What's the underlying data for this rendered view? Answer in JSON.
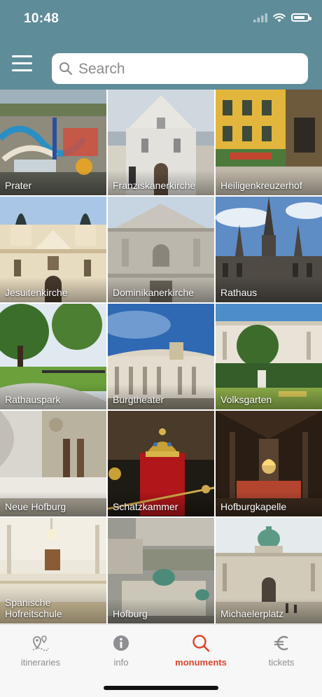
{
  "status_bar": {
    "time": "10:48",
    "icons": [
      "signal-icon",
      "wifi-icon",
      "battery-icon"
    ],
    "battery_level": 0.85
  },
  "header": {
    "menu_icon": "hamburger-menu-icon",
    "search": {
      "placeholder": "Search",
      "value": "",
      "icon": "search-icon"
    }
  },
  "tiles": [
    {
      "label": "Prater"
    },
    {
      "label": "Franziskanerkirche"
    },
    {
      "label": "Heiligenkreuzerhof"
    },
    {
      "label": "Jesuitenkirche"
    },
    {
      "label": "Dominikanerkirche"
    },
    {
      "label": "Rathaus"
    },
    {
      "label": "Rathauspark"
    },
    {
      "label": "Burgtheater"
    },
    {
      "label": "Volksgarten"
    },
    {
      "label": "Neue Hofburg"
    },
    {
      "label": "Schatzkammer"
    },
    {
      "label": "Hofburgkapelle"
    },
    {
      "label": "Spanische Hofreitschule"
    },
    {
      "label": "Hofburg"
    },
    {
      "label": "Michaelerplatz"
    }
  ],
  "tab_bar": {
    "tabs": [
      {
        "label": "itineraries",
        "icon": "map-pin-icon",
        "active": false
      },
      {
        "label": "info",
        "icon": "info-icon",
        "active": false
      },
      {
        "label": "monuments",
        "icon": "search-icon",
        "active": true
      },
      {
        "label": "tickets",
        "icon": "euro-icon",
        "active": false
      }
    ]
  },
  "colors": {
    "header_bg": "#5f8c99",
    "active_tab": "#d8452d",
    "inactive_tab": "#8e8e93"
  }
}
